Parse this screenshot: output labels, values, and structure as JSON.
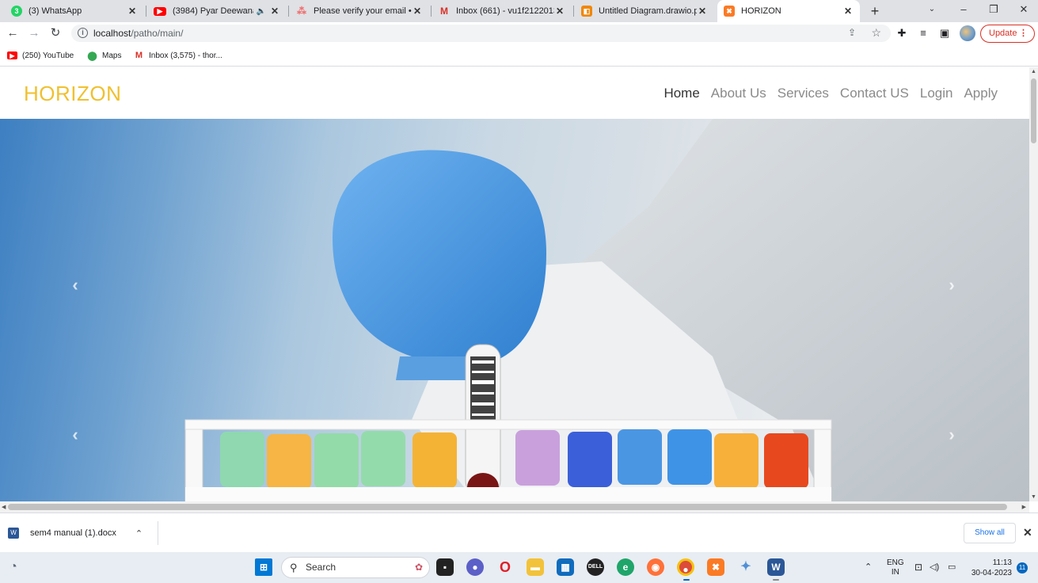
{
  "browser": {
    "tabs": [
      {
        "title": "(3) WhatsApp",
        "icon": "whatsapp-icon",
        "icon_color": "#25d366",
        "badge": "3"
      },
      {
        "title": "(3984) Pyar Deewana H",
        "icon": "youtube-icon",
        "icon_color": "#ff0000",
        "audio": "🔈"
      },
      {
        "title": "Please verify your email • A",
        "icon": "asana-icon",
        "icon_color": "#f06a6a"
      },
      {
        "title": "Inbox (661) - vu1f2122013",
        "icon": "gmail-icon",
        "icon_color": "#d93025"
      },
      {
        "title": "Untitled Diagram.drawio.p",
        "icon": "drawio-icon",
        "icon_color": "#f08705"
      },
      {
        "title": "HORIZON",
        "icon": "xampp-icon",
        "icon_color": "#fb7a24"
      }
    ],
    "url_host": "localhost",
    "url_path": "/patho/main/",
    "update_label": "Update",
    "bookmarks": [
      {
        "label": "(250) YouTube",
        "icon": "youtube-icon",
        "icon_color": "#ff0000"
      },
      {
        "label": "Maps",
        "icon": "maps-pin-icon",
        "icon_color": "#34a853"
      },
      {
        "label": "Inbox (3,575) - thor...",
        "icon": "gmail-icon",
        "icon_color": "#d93025"
      }
    ]
  },
  "site": {
    "brand": "HORIZON",
    "brand_color": "#f0c030",
    "menu": [
      "Home",
      "About Us",
      "Services",
      "Contact US",
      "Login",
      "Apply"
    ],
    "active_menu": "Home"
  },
  "downloads": {
    "file": "sem4 manual (1).docx",
    "show_all": "Show all"
  },
  "taskbar": {
    "search_label": "Search",
    "lang_line1": "ENG",
    "lang_line2": "IN",
    "time": "11:13",
    "date": "30-04-2023",
    "notifications": "11"
  }
}
